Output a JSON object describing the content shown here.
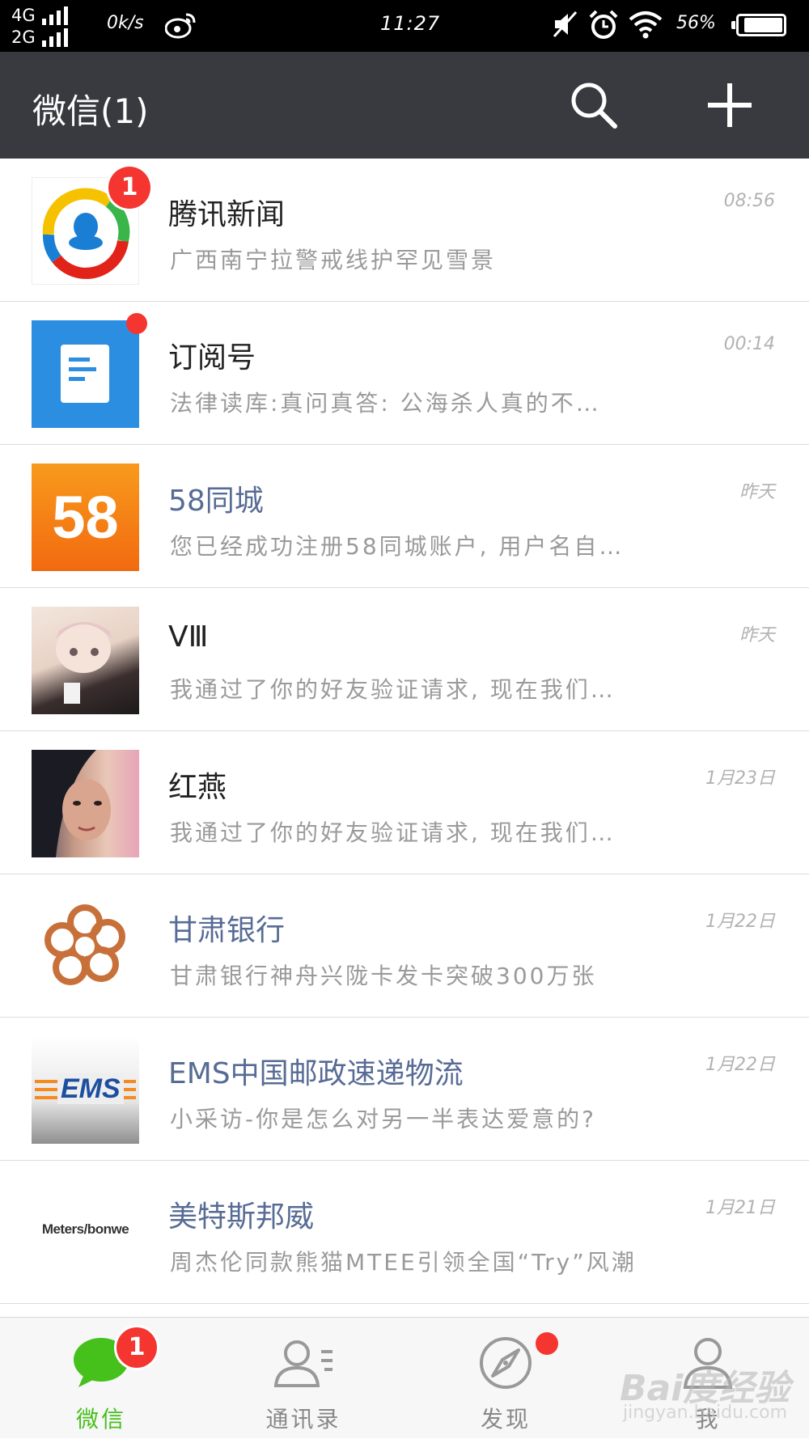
{
  "status_bar": {
    "network_1": "4G",
    "network_2": "2G",
    "speed": "0k/s",
    "time": "11:27",
    "battery": "56%",
    "battery_level": 0.9
  },
  "header": {
    "title": "微信(1)",
    "search_icon": "search-icon",
    "add_icon": "plus-icon"
  },
  "chats": [
    {
      "name": "腾讯新闻",
      "message": "广西南宁拉警戒线护罕见雪景",
      "time": "08:56",
      "official": false,
      "badge": "1"
    },
    {
      "name": "订阅号",
      "message": "法律读库:真问真答: 公海杀人真的不…",
      "time": "00:14",
      "official": false,
      "badge_dot": true
    },
    {
      "name": "58同城",
      "message": "您已经成功注册58同城账户, 用户名自…",
      "time": "昨天",
      "official": true
    },
    {
      "name": "VⅢ",
      "message": "我通过了你的好友验证请求, 现在我们…",
      "time": "昨天",
      "official": false
    },
    {
      "name": "红燕",
      "message": "我通过了你的好友验证请求, 现在我们…",
      "time": "1月23日",
      "official": false
    },
    {
      "name": "甘肃银行",
      "message": "甘肃银行神舟兴陇卡发卡突破300万张",
      "time": "1月22日",
      "official": true
    },
    {
      "name": "EMS中国邮政速递物流",
      "message": "小采访-你是怎么对另一半表达爱意的?",
      "time": "1月22日",
      "official": true
    },
    {
      "name": "美特斯邦威",
      "message": "周杰伦同款熊猫MTEE引领全国“Try”风潮",
      "time": "1月21日",
      "official": true
    }
  ],
  "avatars": {
    "tencent_news": "tencent-news-logo",
    "subscription": "document-icon",
    "tongcheng": "58",
    "ems": "EMS",
    "meters_bonwe": "Meters/bonwe"
  },
  "tabbar": {
    "tabs": [
      {
        "label": "微信",
        "icon": "chat-bubble-icon",
        "active": true,
        "badge": "1"
      },
      {
        "label": "通讯录",
        "icon": "contacts-icon",
        "active": false
      },
      {
        "label": "发现",
        "icon": "compass-icon",
        "active": false,
        "badge_dot": true
      },
      {
        "label": "我",
        "icon": "person-icon",
        "active": false
      }
    ]
  },
  "watermark": {
    "text": "Bai度经验",
    "sub": "jingyan.baidu.com"
  },
  "colors": {
    "header_bg": "#393a3f",
    "badge_red": "#f43530",
    "active_green": "#46c01b",
    "official_blue": "#576b95"
  }
}
